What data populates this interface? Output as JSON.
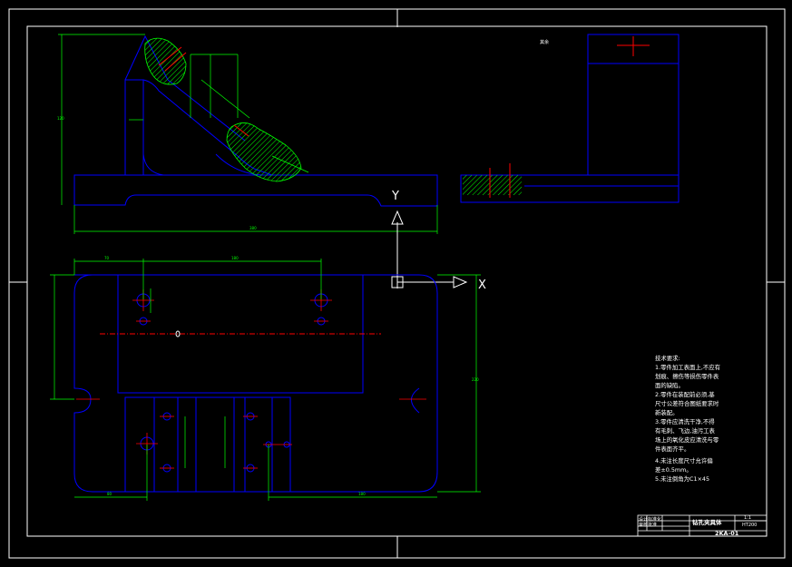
{
  "axes": {
    "x_label": "X",
    "y_label": "Y"
  },
  "roughness_note": "其余",
  "tech_requirements": {
    "title": "技术要求:",
    "lines": [
      "1.零件加工表面上,不应有",
      "划痕、擦伤等损伤零件表",
      "面的缺陷。",
      "2.零件在装配前必须,基",
      "尺寸公差符合图纸要求时",
      "新装配。",
      "3.零件应清洗干净,不得",
      "有毛刺、飞边,油污工表",
      "场上的氧化皮应清洗与零",
      "件表面齐平。",
      "4.未注长度尺寸允许偏",
      "差±0.5mm。",
      "5.未注倒角为C1×45"
    ]
  },
  "title_block": {
    "drawing_no": "2KA-01",
    "scale": "1:1",
    "material": "HT200",
    "part_name": "钻孔夹具体",
    "cells": [
      "设计",
      "审核",
      "标准化",
      "批准"
    ]
  },
  "colors": {
    "outline": "#0000ff",
    "dimension": "#00ff00",
    "centerline": "#ff0000",
    "hatch": "#00ff00",
    "axis": "#ffffff"
  }
}
